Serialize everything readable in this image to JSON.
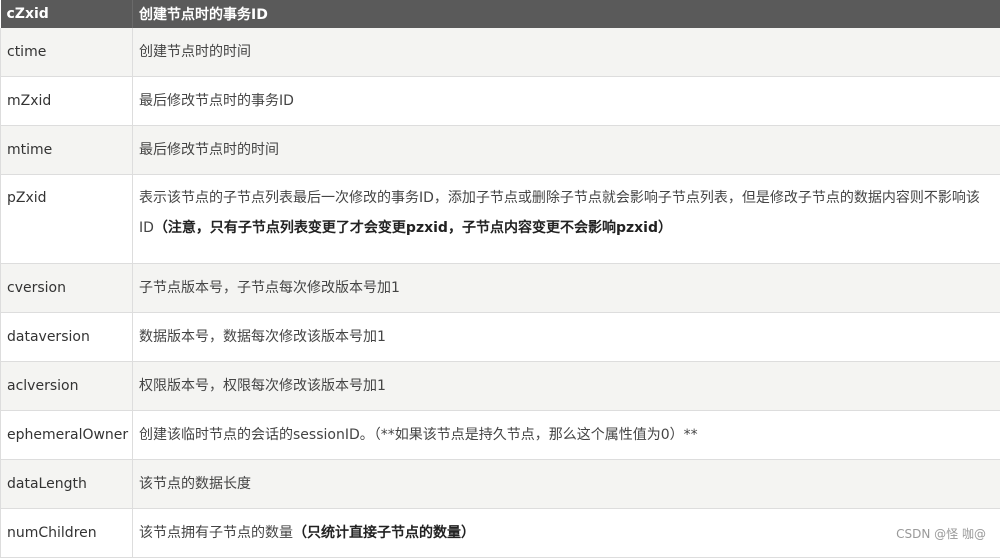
{
  "header": {
    "col1": "cZxid",
    "col2": "创建节点时的事务ID"
  },
  "rows": [
    {
      "name": "ctime",
      "desc": "创建节点时的时间",
      "note": ""
    },
    {
      "name": "mZxid",
      "desc": "最后修改节点时的事务ID",
      "note": ""
    },
    {
      "name": "mtime",
      "desc": "最后修改节点时的时间",
      "note": ""
    },
    {
      "name": "pZxid",
      "desc": "表示该节点的子节点列表最后一次修改的事务ID，添加子节点或删除子节点就会影响子节点列表，但是修改子节点的数据内容则不影响该ID",
      "note": "（注意，只有子节点列表变更了才会变更pzxid，子节点内容变更不会影响pzxid）"
    },
    {
      "name": "cversion",
      "desc": "子节点版本号，子节点每次修改版本号加1",
      "note": ""
    },
    {
      "name": "dataversion",
      "desc": "数据版本号，数据每次修改该版本号加1",
      "note": ""
    },
    {
      "name": "aclversion",
      "desc": "权限版本号，权限每次修改该版本号加1",
      "note": ""
    },
    {
      "name": "ephemeralOwner",
      "desc": "创建该临时节点的会话的sessionID。",
      "note": "（**如果该节点是持久节点，那么这个属性值为0）**"
    },
    {
      "name": "dataLength",
      "desc": "该节点的数据长度",
      "note": ""
    },
    {
      "name": "numChildren",
      "desc": "该节点拥有子节点的数量",
      "note": "（只统计直接子节点的数量）"
    }
  ],
  "watermark": "CSDN @怪 咖@"
}
